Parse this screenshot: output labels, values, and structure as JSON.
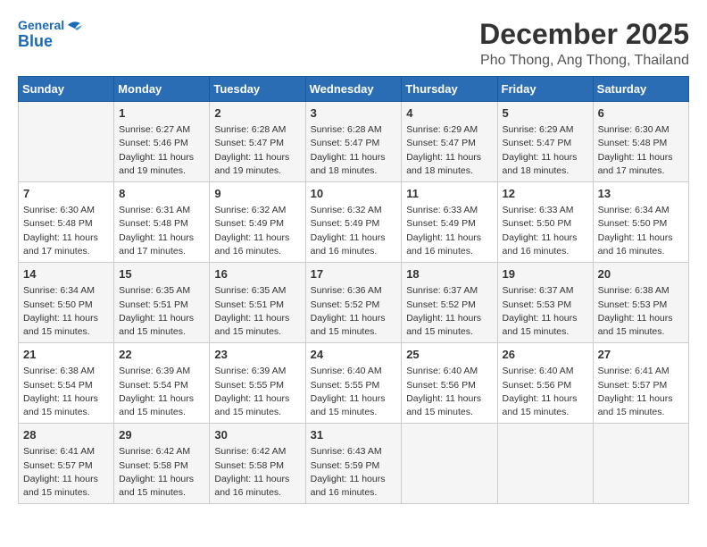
{
  "header": {
    "logo_general": "General",
    "logo_blue": "Blue",
    "month": "December 2025",
    "location": "Pho Thong, Ang Thong, Thailand"
  },
  "weekdays": [
    "Sunday",
    "Monday",
    "Tuesday",
    "Wednesday",
    "Thursday",
    "Friday",
    "Saturday"
  ],
  "weeks": [
    [
      {
        "day": "",
        "info": ""
      },
      {
        "day": "1",
        "info": "Sunrise: 6:27 AM\nSunset: 5:46 PM\nDaylight: 11 hours\nand 19 minutes."
      },
      {
        "day": "2",
        "info": "Sunrise: 6:28 AM\nSunset: 5:47 PM\nDaylight: 11 hours\nand 19 minutes."
      },
      {
        "day": "3",
        "info": "Sunrise: 6:28 AM\nSunset: 5:47 PM\nDaylight: 11 hours\nand 18 minutes."
      },
      {
        "day": "4",
        "info": "Sunrise: 6:29 AM\nSunset: 5:47 PM\nDaylight: 11 hours\nand 18 minutes."
      },
      {
        "day": "5",
        "info": "Sunrise: 6:29 AM\nSunset: 5:47 PM\nDaylight: 11 hours\nand 18 minutes."
      },
      {
        "day": "6",
        "info": "Sunrise: 6:30 AM\nSunset: 5:48 PM\nDaylight: 11 hours\nand 17 minutes."
      }
    ],
    [
      {
        "day": "7",
        "info": "Sunrise: 6:30 AM\nSunset: 5:48 PM\nDaylight: 11 hours\nand 17 minutes."
      },
      {
        "day": "8",
        "info": "Sunrise: 6:31 AM\nSunset: 5:48 PM\nDaylight: 11 hours\nand 17 minutes."
      },
      {
        "day": "9",
        "info": "Sunrise: 6:32 AM\nSunset: 5:49 PM\nDaylight: 11 hours\nand 16 minutes."
      },
      {
        "day": "10",
        "info": "Sunrise: 6:32 AM\nSunset: 5:49 PM\nDaylight: 11 hours\nand 16 minutes."
      },
      {
        "day": "11",
        "info": "Sunrise: 6:33 AM\nSunset: 5:49 PM\nDaylight: 11 hours\nand 16 minutes."
      },
      {
        "day": "12",
        "info": "Sunrise: 6:33 AM\nSunset: 5:50 PM\nDaylight: 11 hours\nand 16 minutes."
      },
      {
        "day": "13",
        "info": "Sunrise: 6:34 AM\nSunset: 5:50 PM\nDaylight: 11 hours\nand 16 minutes."
      }
    ],
    [
      {
        "day": "14",
        "info": "Sunrise: 6:34 AM\nSunset: 5:50 PM\nDaylight: 11 hours\nand 15 minutes."
      },
      {
        "day": "15",
        "info": "Sunrise: 6:35 AM\nSunset: 5:51 PM\nDaylight: 11 hours\nand 15 minutes."
      },
      {
        "day": "16",
        "info": "Sunrise: 6:35 AM\nSunset: 5:51 PM\nDaylight: 11 hours\nand 15 minutes."
      },
      {
        "day": "17",
        "info": "Sunrise: 6:36 AM\nSunset: 5:52 PM\nDaylight: 11 hours\nand 15 minutes."
      },
      {
        "day": "18",
        "info": "Sunrise: 6:37 AM\nSunset: 5:52 PM\nDaylight: 11 hours\nand 15 minutes."
      },
      {
        "day": "19",
        "info": "Sunrise: 6:37 AM\nSunset: 5:53 PM\nDaylight: 11 hours\nand 15 minutes."
      },
      {
        "day": "20",
        "info": "Sunrise: 6:38 AM\nSunset: 5:53 PM\nDaylight: 11 hours\nand 15 minutes."
      }
    ],
    [
      {
        "day": "21",
        "info": "Sunrise: 6:38 AM\nSunset: 5:54 PM\nDaylight: 11 hours\nand 15 minutes."
      },
      {
        "day": "22",
        "info": "Sunrise: 6:39 AM\nSunset: 5:54 PM\nDaylight: 11 hours\nand 15 minutes."
      },
      {
        "day": "23",
        "info": "Sunrise: 6:39 AM\nSunset: 5:55 PM\nDaylight: 11 hours\nand 15 minutes."
      },
      {
        "day": "24",
        "info": "Sunrise: 6:40 AM\nSunset: 5:55 PM\nDaylight: 11 hours\nand 15 minutes."
      },
      {
        "day": "25",
        "info": "Sunrise: 6:40 AM\nSunset: 5:56 PM\nDaylight: 11 hours\nand 15 minutes."
      },
      {
        "day": "26",
        "info": "Sunrise: 6:40 AM\nSunset: 5:56 PM\nDaylight: 11 hours\nand 15 minutes."
      },
      {
        "day": "27",
        "info": "Sunrise: 6:41 AM\nSunset: 5:57 PM\nDaylight: 11 hours\nand 15 minutes."
      }
    ],
    [
      {
        "day": "28",
        "info": "Sunrise: 6:41 AM\nSunset: 5:57 PM\nDaylight: 11 hours\nand 15 minutes."
      },
      {
        "day": "29",
        "info": "Sunrise: 6:42 AM\nSunset: 5:58 PM\nDaylight: 11 hours\nand 15 minutes."
      },
      {
        "day": "30",
        "info": "Sunrise: 6:42 AM\nSunset: 5:58 PM\nDaylight: 11 hours\nand 16 minutes."
      },
      {
        "day": "31",
        "info": "Sunrise: 6:43 AM\nSunset: 5:59 PM\nDaylight: 11 hours\nand 16 minutes."
      },
      {
        "day": "",
        "info": ""
      },
      {
        "day": "",
        "info": ""
      },
      {
        "day": "",
        "info": ""
      }
    ]
  ]
}
